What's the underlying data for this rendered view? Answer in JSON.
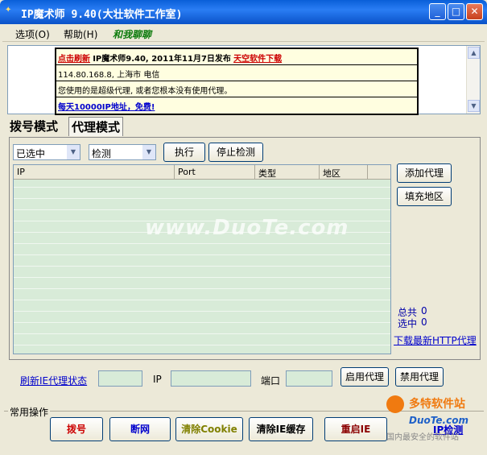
{
  "window": {
    "title": "IP魔术师 9.40(大壮软件工作室)",
    "minimize": "_",
    "maximize": "□",
    "close": "✕"
  },
  "menu": {
    "options": "选项(O)",
    "help": "帮助(H)",
    "promo": "和我聊聊"
  },
  "info": {
    "refresh_link": "点击刷新",
    "release_text": "IP魔术师9.40, 2011年11月7日发布",
    "download_link": "天空软件下载",
    "ip_location": "114.80.168.8, 上海市 电信",
    "proxy_status": "您使用的是超级代理, 或者您根本没有使用代理。",
    "free_ip_link": "每天10000IP地址，免费!"
  },
  "tabs": [
    "拨号模式",
    "代理模式"
  ],
  "proxy": {
    "filter_select": "已选中",
    "action_select": "检测",
    "execute_button": "执行",
    "stop_button": "停止检测",
    "columns": [
      "IP",
      "Port",
      "类型",
      "地区"
    ],
    "add_proxy_button": "添加代理",
    "fill_region_button": "填充地区",
    "total_label": "总共",
    "total_value": "0",
    "selected_label": "选中",
    "selected_value": "0",
    "download_link": "下载最新HTTP代理"
  },
  "watermark": "www.DuoTe.com",
  "status_bar": {
    "refresh_link": "刷新IE代理状态",
    "ip_label": "IP",
    "port_label": "端口",
    "enable_button": "启用代理",
    "disable_button": "禁用代理"
  },
  "operations": {
    "title": "常用操作",
    "buttons": [
      {
        "label": "拨号",
        "color": "#cc0000"
      },
      {
        "label": "断网",
        "color": "#0000cc"
      },
      {
        "label": "清除Cookie",
        "color": "#808000"
      },
      {
        "label": "清除IE缓存",
        "color": "#000000"
      },
      {
        "label": "重启IE",
        "color": "#8b0000"
      }
    ],
    "ip_check_link": "IP检测"
  },
  "logo": {
    "brand": "多特软件站",
    "url": "DuoTe.com",
    "slogan": "国内最安全的软件站"
  }
}
